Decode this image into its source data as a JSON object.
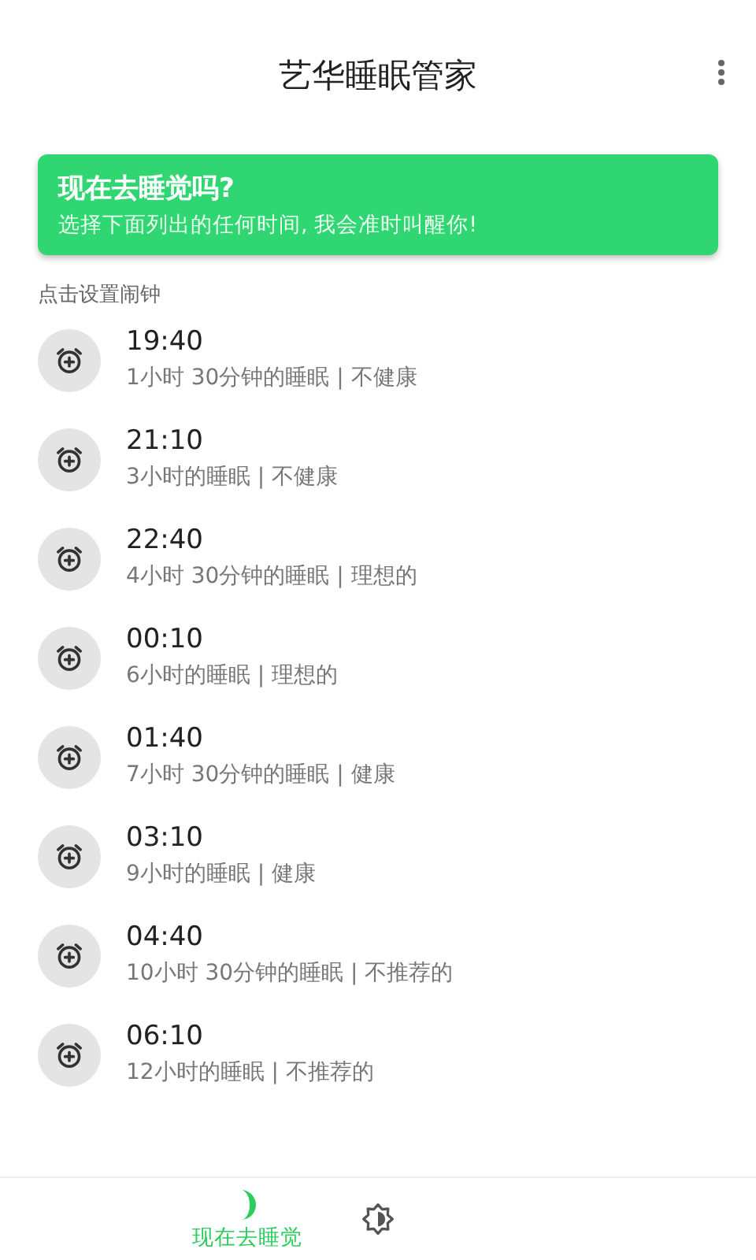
{
  "app_bar": {
    "title": "艺华睡眠管家"
  },
  "banner": {
    "title": "现在去睡觉吗?",
    "subtitle": "选择下面列出的任何时间, 我会准时叫醒你!"
  },
  "section_label": "点击设置闹钟",
  "alarms": [
    {
      "time": "19:40",
      "detail": "1小时 30分钟的睡眠 | 不健康"
    },
    {
      "time": "21:10",
      "detail": "3小时的睡眠 | 不健康"
    },
    {
      "time": "22:40",
      "detail": "4小时 30分钟的睡眠 | 理想的"
    },
    {
      "time": "00:10",
      "detail": "6小时的睡眠 | 理想的"
    },
    {
      "time": "01:40",
      "detail": "7小时 30分钟的睡眠 | 健康"
    },
    {
      "time": "03:10",
      "detail": "9小时的睡眠 | 健康"
    },
    {
      "time": "04:40",
      "detail": "10小时 30分钟的睡眠 | 不推荐的"
    },
    {
      "time": "06:10",
      "detail": "12小时的睡眠 | 不推荐的"
    }
  ],
  "bottom_nav": [
    {
      "kind": "moon",
      "label": "现在去睡觉",
      "selected": true
    },
    {
      "kind": "brightness",
      "selected": false
    }
  ]
}
